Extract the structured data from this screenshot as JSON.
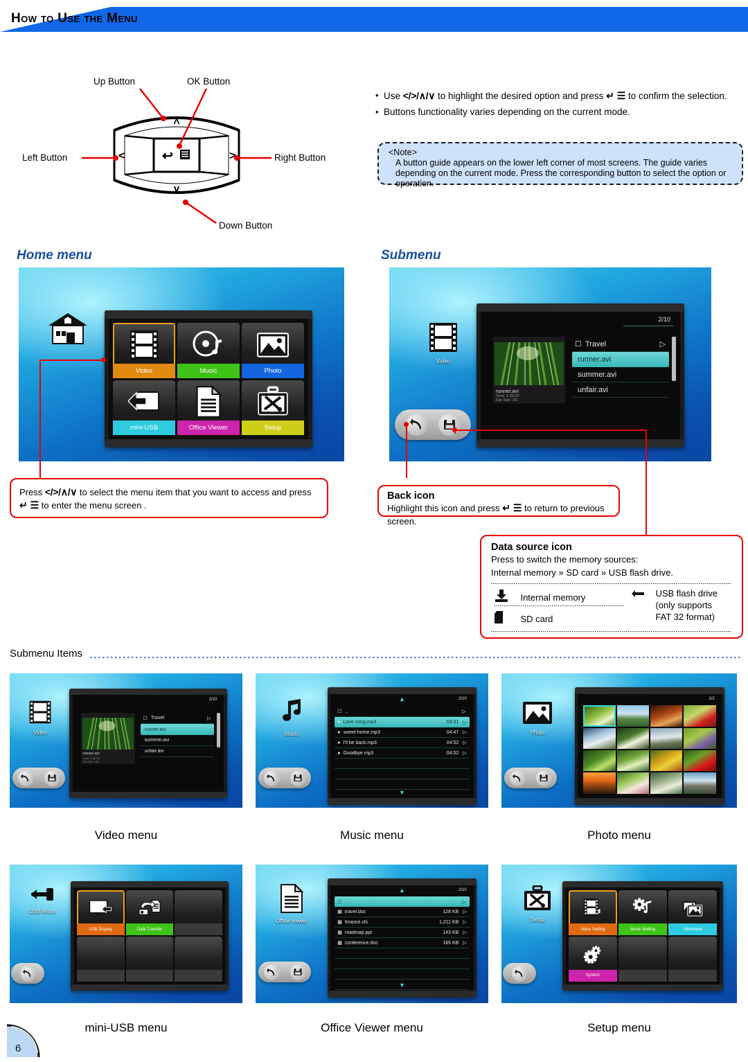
{
  "header": {
    "title": "How to Use the Menu"
  },
  "nav_diagram": {
    "up_label": "Up Button",
    "ok_label": "OK Button",
    "left_label": "Left Button",
    "right_label": "Right Button",
    "down_label": "Down Button",
    "glyph_up": "∧",
    "glyph_down": "∨",
    "glyph_left": "＜",
    "glyph_right": "＞",
    "glyph_enter": "↵",
    "glyph_menu": "☰"
  },
  "instructions": {
    "bullet1_a": "Use ",
    "bullet1_keys": "</>/∧/∨",
    "bullet1_b": " to highlight the desired option and press ",
    "bullet1_ok": "↵ ☰",
    "bullet1_c": " to confirm the selection.",
    "bullet2": "Buttons functionality varies depending on the current mode."
  },
  "note": {
    "title": "<Note>",
    "body": "A button guide appears on the lower left corner of most screens. The guide varies depending on the current mode. Press the corresponding button to select the option or operation."
  },
  "home_menu": {
    "caption": "Home menu",
    "side_icon_name": "house-icon",
    "tiles": [
      {
        "label": "Video",
        "color": "#e08a10",
        "icon": "film-icon",
        "selected": true
      },
      {
        "label": "Music",
        "color": "#3fc318",
        "icon": "cd-music-icon",
        "selected": false
      },
      {
        "label": "Photo",
        "color": "#1565e0",
        "icon": "picture-icon",
        "selected": false
      },
      {
        "label": "mini-USB",
        "color": "#2ecbe0",
        "icon": "usb-in-icon",
        "selected": false
      },
      {
        "label": "Office Viewer",
        "color": "#cc24aa",
        "icon": "document-icon",
        "selected": false
      },
      {
        "label": "Setup",
        "color": "#cfcf1a",
        "icon": "toolbox-icon",
        "selected": false
      }
    ]
  },
  "home_callout": {
    "text_a": "Press ",
    "keys": "</>/∧/∨",
    "text_b": " to select the menu item that you want to access and press",
    "ok": "↵ ☰",
    "text_c": " to enter the menu screen ."
  },
  "submenu": {
    "caption": "Submenu",
    "side_icon_label": "Video",
    "page_indicator": "2/10",
    "folder": "Travel",
    "files": [
      {
        "name": "runner.avi",
        "selected": true
      },
      {
        "name": "summer.avi",
        "selected": false
      },
      {
        "name": "unfair.avi",
        "selected": false
      }
    ],
    "detail_name": "runner.avi",
    "detail_time": "Time: 1:30:20",
    "detail_size": "File Size: 2G"
  },
  "back_callout": {
    "title": "Back icon",
    "text_a": "Highlight this icon and press ",
    "ok": "↵ ☰",
    "text_b": " to return to previous screen."
  },
  "datasource_callout": {
    "title": "Data source icon",
    "line1": "Press to switch the memory sources:",
    "line2": "Internal memory » SD card » USB flash drive.",
    "items": [
      {
        "icon": "internal-memory-icon",
        "label": "Internal memory"
      },
      {
        "icon": "sd-card-icon",
        "label": "SD card"
      },
      {
        "icon": "usb-flash-icon",
        "label": "USB flash drive (only supports FAT 32 format)"
      }
    ],
    "usb_label_l1": "USB flash drive",
    "usb_label_l2": "(only supports",
    "usb_label_l3": "FAT 32 format)"
  },
  "submenu_items": {
    "heading": "Submenu Items",
    "video": {
      "caption": "Video menu",
      "side_label": "Video",
      "page_indicator": "2/10",
      "folder": "Travel",
      "files": [
        {
          "name": "runner.avi",
          "selected": true
        },
        {
          "name": "summer.avi",
          "selected": false
        },
        {
          "name": "unfair.avi",
          "selected": false
        }
      ],
      "detail_name": "runner.avi",
      "detail_time": "Time: 1:30:20",
      "detail_size": "File Size: 2G"
    },
    "music": {
      "caption": "Music menu",
      "side_label": "Music",
      "page_indicator": "2/10",
      "parent_row": "..",
      "files": [
        {
          "name": "Love song.mp3",
          "size": "03:31",
          "selected": true
        },
        {
          "name": "sweet home.mp3",
          "size": "04:47",
          "selected": false
        },
        {
          "name": "I'll be back.mp3",
          "size": "04:52",
          "selected": false
        },
        {
          "name": "Goodbye.mp3",
          "size": "04:52",
          "selected": false
        }
      ]
    },
    "photo": {
      "caption": "Photo menu",
      "side_label": "Photo",
      "page_indicator": "1/2",
      "cells": 16,
      "selected_cell": 0
    },
    "usb": {
      "caption": "mini-USB menu",
      "side_label": "USB Mode",
      "tiles": [
        {
          "label": "USB Display",
          "color": "#e06a10",
          "icon": "usb-display-icon",
          "selected": true
        },
        {
          "label": "Data Transfer",
          "color": "#3fc318",
          "icon": "data-transfer-icon",
          "selected": false
        }
      ]
    },
    "office": {
      "caption": "Office Viewer menu",
      "side_label": "Office viewer",
      "page_indicator": "2/10",
      "parent_row": "..",
      "files": [
        {
          "name": "travel.doc",
          "size": "128 KB",
          "selected": false
        },
        {
          "name": "finance.xls",
          "size": "1,211 KB",
          "selected": false
        },
        {
          "name": "roadmap.ppt",
          "size": "143 KB",
          "selected": false
        },
        {
          "name": "conference.doc",
          "size": "165 KB",
          "selected": false
        }
      ]
    },
    "setup": {
      "caption": "Setup menu",
      "side_label": "Setup",
      "tiles": [
        {
          "label": "Video Setting",
          "color": "#e06a10",
          "icon": "video-setting-icon",
          "selected": true
        },
        {
          "label": "Music Setting",
          "color": "#3fc318",
          "icon": "music-setting-icon",
          "selected": false
        },
        {
          "label": "Slideshow",
          "color": "#2ecbe0",
          "icon": "slideshow-icon",
          "selected": false
        },
        {
          "label": "System",
          "color": "#cc24aa",
          "icon": "system-gear-icon",
          "selected": false
        }
      ]
    }
  },
  "footer": {
    "page_number": "6"
  },
  "colors": {
    "header_blue": "#1068e8",
    "accent_red": "#e60000",
    "caption_blue": "#1a4fa0",
    "note_bg": "#cfe2fb"
  }
}
